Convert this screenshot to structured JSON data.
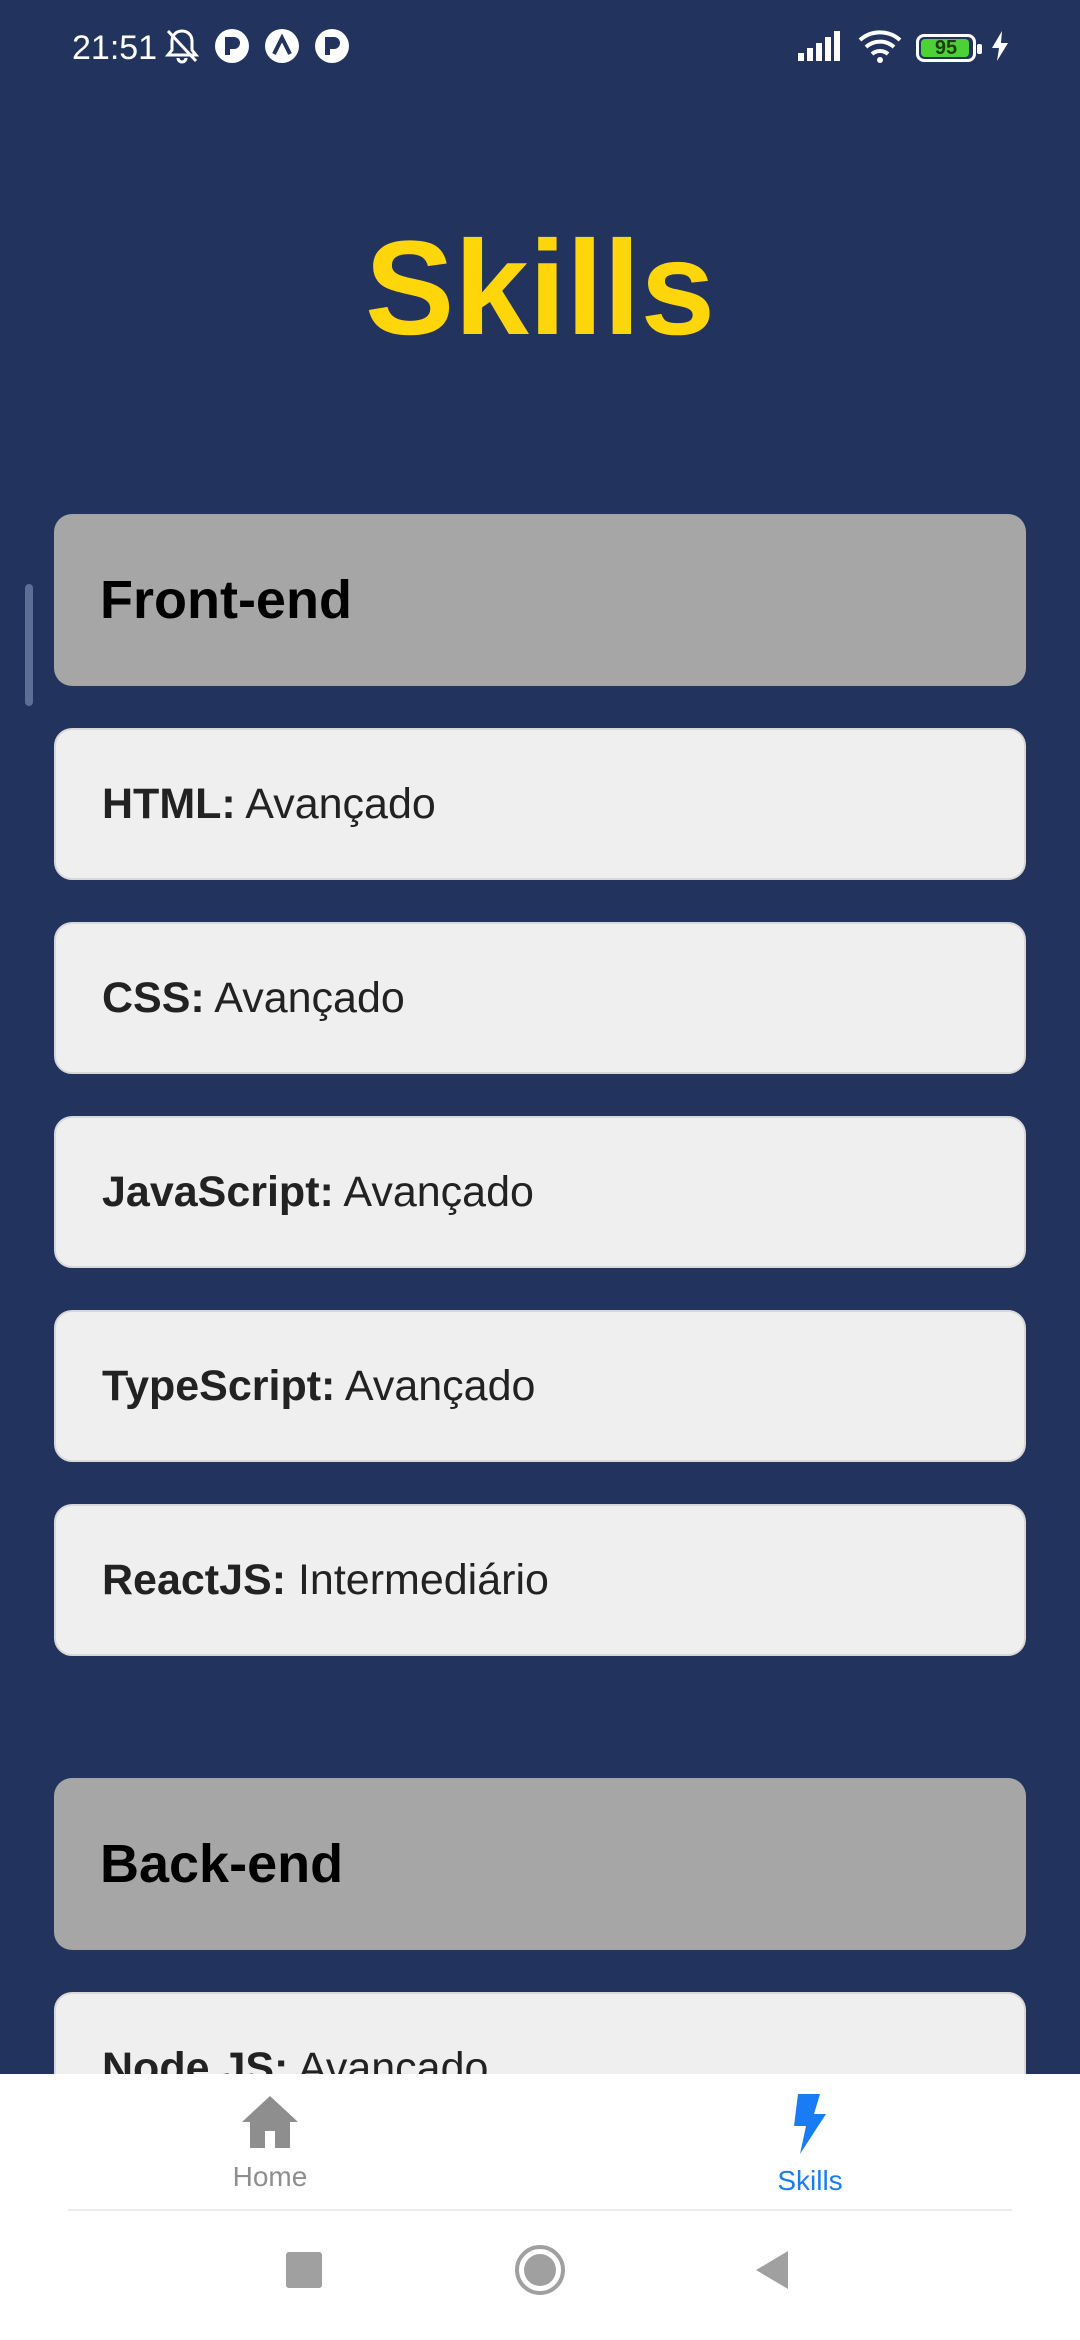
{
  "status_bar": {
    "time": "21:51",
    "battery_percent": "95",
    "left_icons": [
      "bell-off-icon",
      "app-notification-icon",
      "app-notification-icon",
      "app-notification-icon"
    ],
    "right_icons": [
      "signal-icon",
      "wifi-icon",
      "battery-icon",
      "charging-icon"
    ],
    "battery_color": "#4cd137"
  },
  "page": {
    "title": "Skills",
    "title_color": "#ffd60a",
    "background": "#22345d"
  },
  "sections": [
    {
      "header": "Front-end",
      "skills": [
        {
          "name": "HTML:",
          "level": " Avançado"
        },
        {
          "name": "CSS:",
          "level": " Avançado"
        },
        {
          "name": "JavaScript:",
          "level": " Avançado"
        },
        {
          "name": "TypeScript:",
          "level": " Avançado"
        },
        {
          "name": "ReactJS:",
          "level": " Intermediário"
        }
      ]
    },
    {
      "header": "Back-end",
      "skills": [
        {
          "name": "Node.JS:",
          "level": " Avançado"
        }
      ]
    }
  ],
  "tab_bar": {
    "tabs": [
      {
        "label": "Home",
        "icon": "home-icon",
        "active": false
      },
      {
        "label": "Skills",
        "icon": "lightning-bolt-icon",
        "active": true
      }
    ],
    "active_color": "#1a7cf5",
    "inactive_color": "#8e8e8e"
  },
  "nav_bar": {
    "buttons": [
      "recents-square-icon",
      "home-circle-icon",
      "back-triangle-icon"
    ]
  }
}
